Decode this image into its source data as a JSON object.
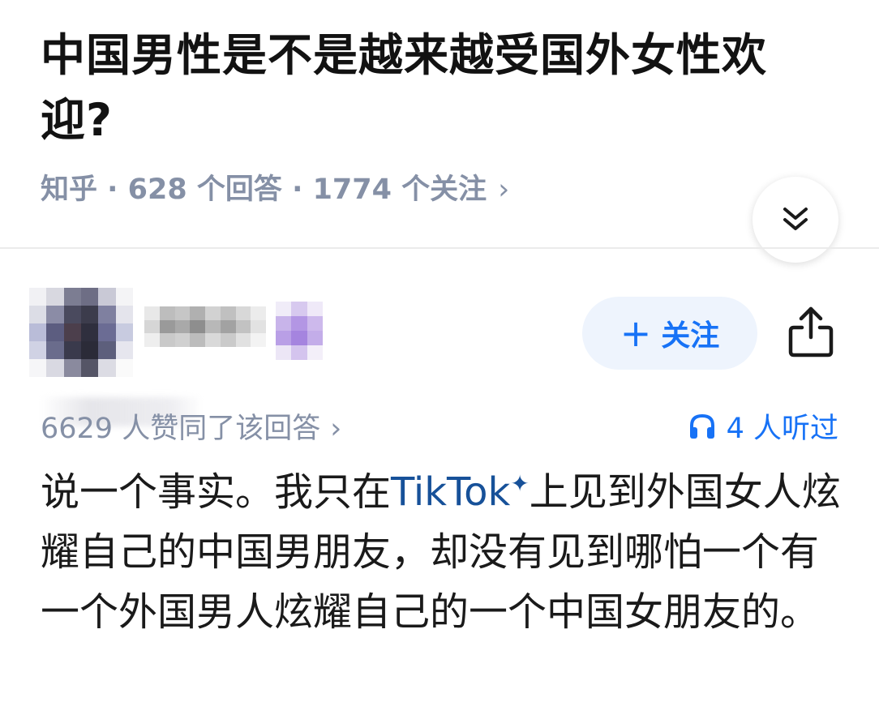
{
  "question": {
    "title": "中国男性是不是越来越受国外女性欢迎?",
    "meta": "知乎 · 628 个回答 · 1774 个关注",
    "meta_chevron": "›"
  },
  "author": {
    "follow_plus": "+",
    "follow_label": "关注"
  },
  "answer": {
    "endorse_text": "6629 人赞同了该回答",
    "endorse_chevron": "›",
    "listen_text": "4 人听过",
    "body_prefix": " 说一个事实。我只在",
    "body_link": "TikTok",
    "body_sparkle": "✦",
    "body_suffix": "上见到外国女人炫耀自己的中国男朋友，却没有见到哪怕一个有一个外国男人炫耀自己的一个中国女朋友的。"
  },
  "colors": {
    "accent": "#1772f6",
    "meta_gray": "#8590a6",
    "link_blue": "#175199",
    "follow_bg": "#eef4fd"
  },
  "icons": {
    "expand": "double-chevron-down-icon",
    "share": "share-icon",
    "listen": "headphones-icon"
  }
}
